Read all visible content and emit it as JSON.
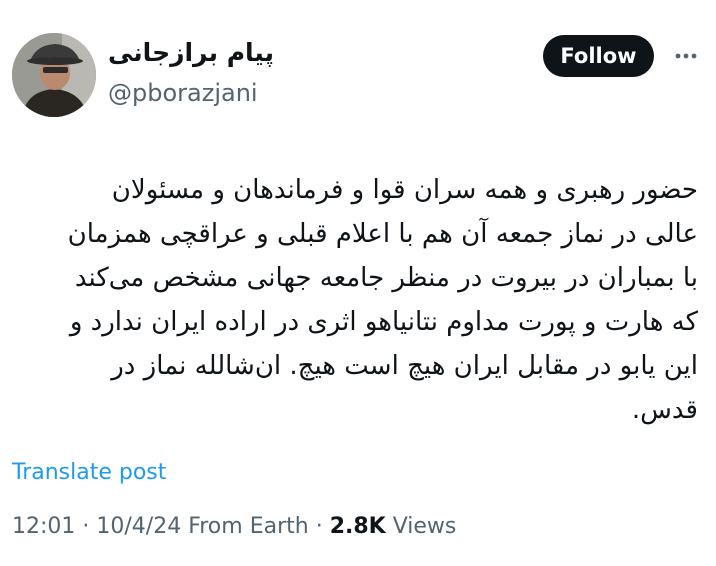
{
  "author": {
    "name": "پیام برازجانی",
    "handle": "@pborazjani"
  },
  "follow_label": "Follow",
  "more_icon": "more-horizontal-icon",
  "post": {
    "lines": [
      "حضور رهبری و همه سران قوا و فرماندهان و مسئولان",
      "عالی در نماز جمعه آن هم با اعلام قبلی و عراقچی همزمان",
      "با بمباران در بیروت در منظر جامعه جهانی مشخص می‌کند",
      "که هارت و پورت مداوم نتانیاهو اثری در اراده ایران ندارد و",
      "این یابو در مقابل ایران هیچ است هیچ. ان‌شالله نماز در",
      "قدس."
    ]
  },
  "translate_label": "Translate post",
  "meta": {
    "time": "12:01",
    "sep1": " · ",
    "date": "10/4/24",
    "source": " From Earth",
    "sep2": " · ",
    "views_count": "2.8K",
    "views_label": " Views"
  },
  "colors": {
    "text": "#0f1419",
    "secondary": "#536471",
    "link": "#1d9bf0",
    "follow_bg": "#0f1419"
  }
}
